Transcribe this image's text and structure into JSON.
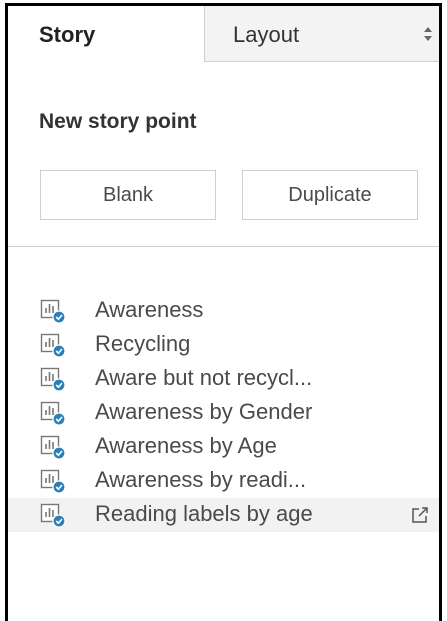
{
  "tabs": {
    "story": "Story",
    "layout": "Layout"
  },
  "new_story_point": {
    "title": "New story point",
    "blank_label": "Blank",
    "duplicate_label": "Duplicate"
  },
  "story_points": [
    {
      "label": "Awareness",
      "icon": "sheet-icon"
    },
    {
      "label": "Recycling",
      "icon": "sheet-icon"
    },
    {
      "label": "Aware but not recycl...",
      "icon": "sheet-icon"
    },
    {
      "label": "Awareness by Gender",
      "icon": "sheet-icon"
    },
    {
      "label": "Awareness by Age",
      "icon": "sheet-icon"
    },
    {
      "label": "Awareness by readi...",
      "icon": "sheet-icon"
    },
    {
      "label": "Reading labels by age",
      "icon": "sheet-icon",
      "hovered": true
    }
  ],
  "icons": {
    "sort": "sort-icon",
    "open_sheet": "open-external-icon"
  },
  "colors": {
    "accent_badge": "#2d7fb8",
    "hover_row": "#f2f2f2",
    "tab_inactive": "#f3f3f3"
  }
}
